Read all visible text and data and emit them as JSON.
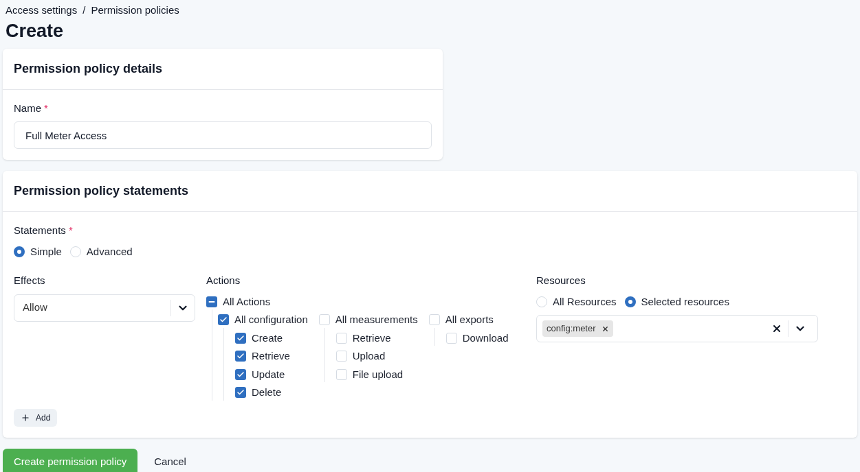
{
  "breadcrumb": {
    "items": [
      "Access settings",
      "Permission policies"
    ],
    "separator": "/"
  },
  "title": "Create",
  "details_card": {
    "title": "Permission policy details",
    "name_field": {
      "label": "Name",
      "required_mark": "*",
      "value": "Full Meter Access"
    }
  },
  "statements_card": {
    "title": "Permission policy statements",
    "statements": {
      "label": "Statements",
      "required_mark": "*",
      "options": [
        {
          "label": "Simple",
          "selected": true
        },
        {
          "label": "Advanced",
          "selected": false
        }
      ]
    },
    "effects": {
      "label": "Effects",
      "value": "Allow"
    },
    "actions": {
      "label": "Actions",
      "all": {
        "label": "All Actions",
        "indeterminate": true
      },
      "groups": [
        {
          "label": "All configuration",
          "checked": true,
          "children": [
            {
              "label": "Create",
              "checked": true
            },
            {
              "label": "Retrieve",
              "checked": true
            },
            {
              "label": "Update",
              "checked": true
            },
            {
              "label": "Delete",
              "checked": true
            }
          ]
        },
        {
          "label": "All measurements",
          "checked": false,
          "children": [
            {
              "label": "Retrieve",
              "checked": false
            },
            {
              "label": "Upload",
              "checked": false
            },
            {
              "label": "File upload",
              "checked": false
            }
          ]
        },
        {
          "label": "All exports",
          "checked": false,
          "children": [
            {
              "label": "Download",
              "checked": false
            }
          ]
        }
      ]
    },
    "resources": {
      "label": "Resources",
      "options": [
        {
          "label": "All Resources",
          "selected": false
        },
        {
          "label": "Selected resources",
          "selected": true
        }
      ],
      "chips": [
        "config:meter"
      ]
    },
    "add_button": "Add"
  },
  "buttons": {
    "submit": "Create permission policy",
    "cancel": "Cancel"
  }
}
